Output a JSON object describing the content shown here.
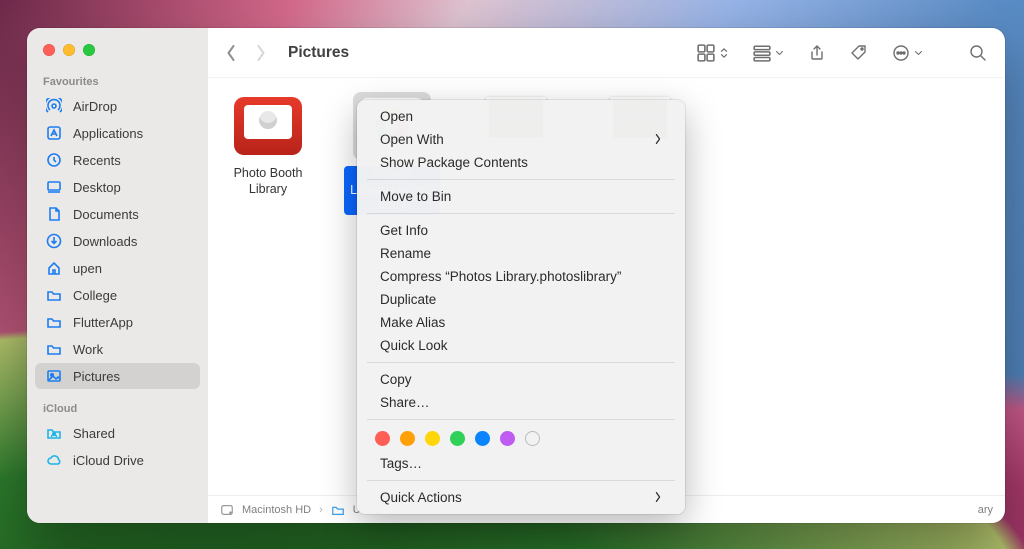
{
  "window": {
    "title": "Pictures"
  },
  "sidebar": {
    "section_favourites": "Favourites",
    "section_icloud": "iCloud",
    "items": [
      {
        "label": "AirDrop"
      },
      {
        "label": "Applications"
      },
      {
        "label": "Recents"
      },
      {
        "label": "Desktop"
      },
      {
        "label": "Documents"
      },
      {
        "label": "Downloads"
      },
      {
        "label": "upen"
      },
      {
        "label": "College"
      },
      {
        "label": "FlutterApp"
      },
      {
        "label": "Work"
      },
      {
        "label": "Pictures"
      }
    ],
    "icloud": [
      {
        "label": "Shared"
      },
      {
        "label": "iCloud Drive"
      }
    ]
  },
  "files": {
    "f0": "Photo Booth Library",
    "f1": "Photos Library.photoslibrary"
  },
  "pathbar": {
    "p0": "Macintosh HD",
    "p1": "Users",
    "p2_tail": "ary"
  },
  "menu": {
    "open": "Open",
    "open_with": "Open With",
    "show_pkg": "Show Package Contents",
    "move_bin": "Move to Bin",
    "get_info": "Get Info",
    "rename": "Rename",
    "compress": "Compress “Photos Library.photoslibrary”",
    "duplicate": "Duplicate",
    "make_alias": "Make Alias",
    "quick_look": "Quick Look",
    "copy": "Copy",
    "share": "Share…",
    "tags": "Tags…",
    "quick_actions": "Quick Actions",
    "tag_colors": [
      "#ff5e57",
      "#ff9f0a",
      "#ffd60a",
      "#30d158",
      "#0a84ff",
      "#bf5af2"
    ]
  }
}
